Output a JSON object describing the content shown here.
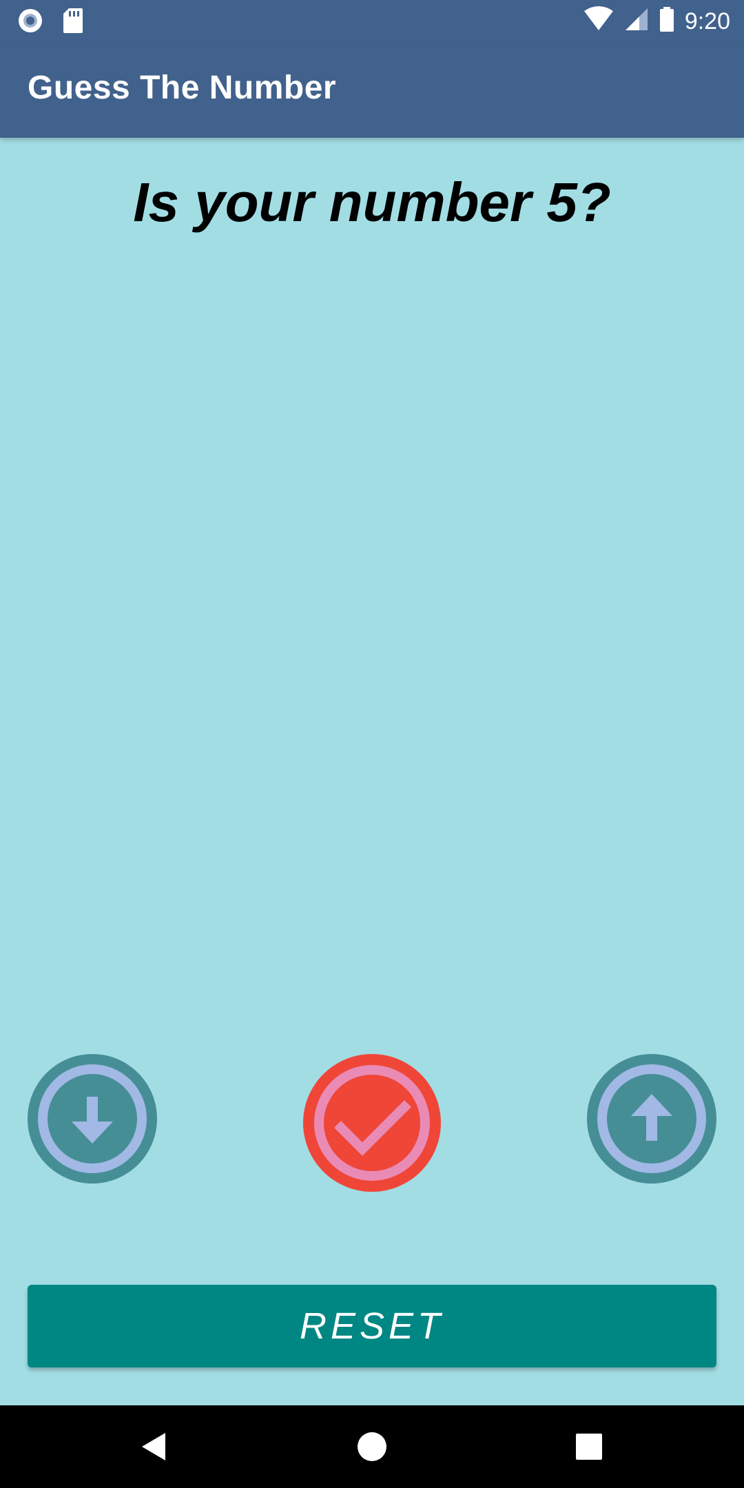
{
  "status_bar": {
    "time": "9:20",
    "icons": [
      "record-icon",
      "sd-card-icon",
      "wifi-icon",
      "cell-signal-icon",
      "battery-icon"
    ]
  },
  "app_bar": {
    "title": "Guess The Number"
  },
  "main": {
    "question": "Is your number 5?"
  },
  "actions": {
    "lower_icon": "arrow-down-circle-icon",
    "correct_icon": "check-circle-icon",
    "higher_icon": "arrow-up-circle-icon",
    "reset_label": "RESET"
  },
  "nav_bar": {
    "icons": [
      "back-icon",
      "home-icon",
      "recents-icon"
    ]
  },
  "colors": {
    "app_bar": "#41628c",
    "background": "#a2dde4",
    "reset_button": "#008784",
    "correct_button": "#ef4638",
    "direction_button": "#468e96"
  }
}
